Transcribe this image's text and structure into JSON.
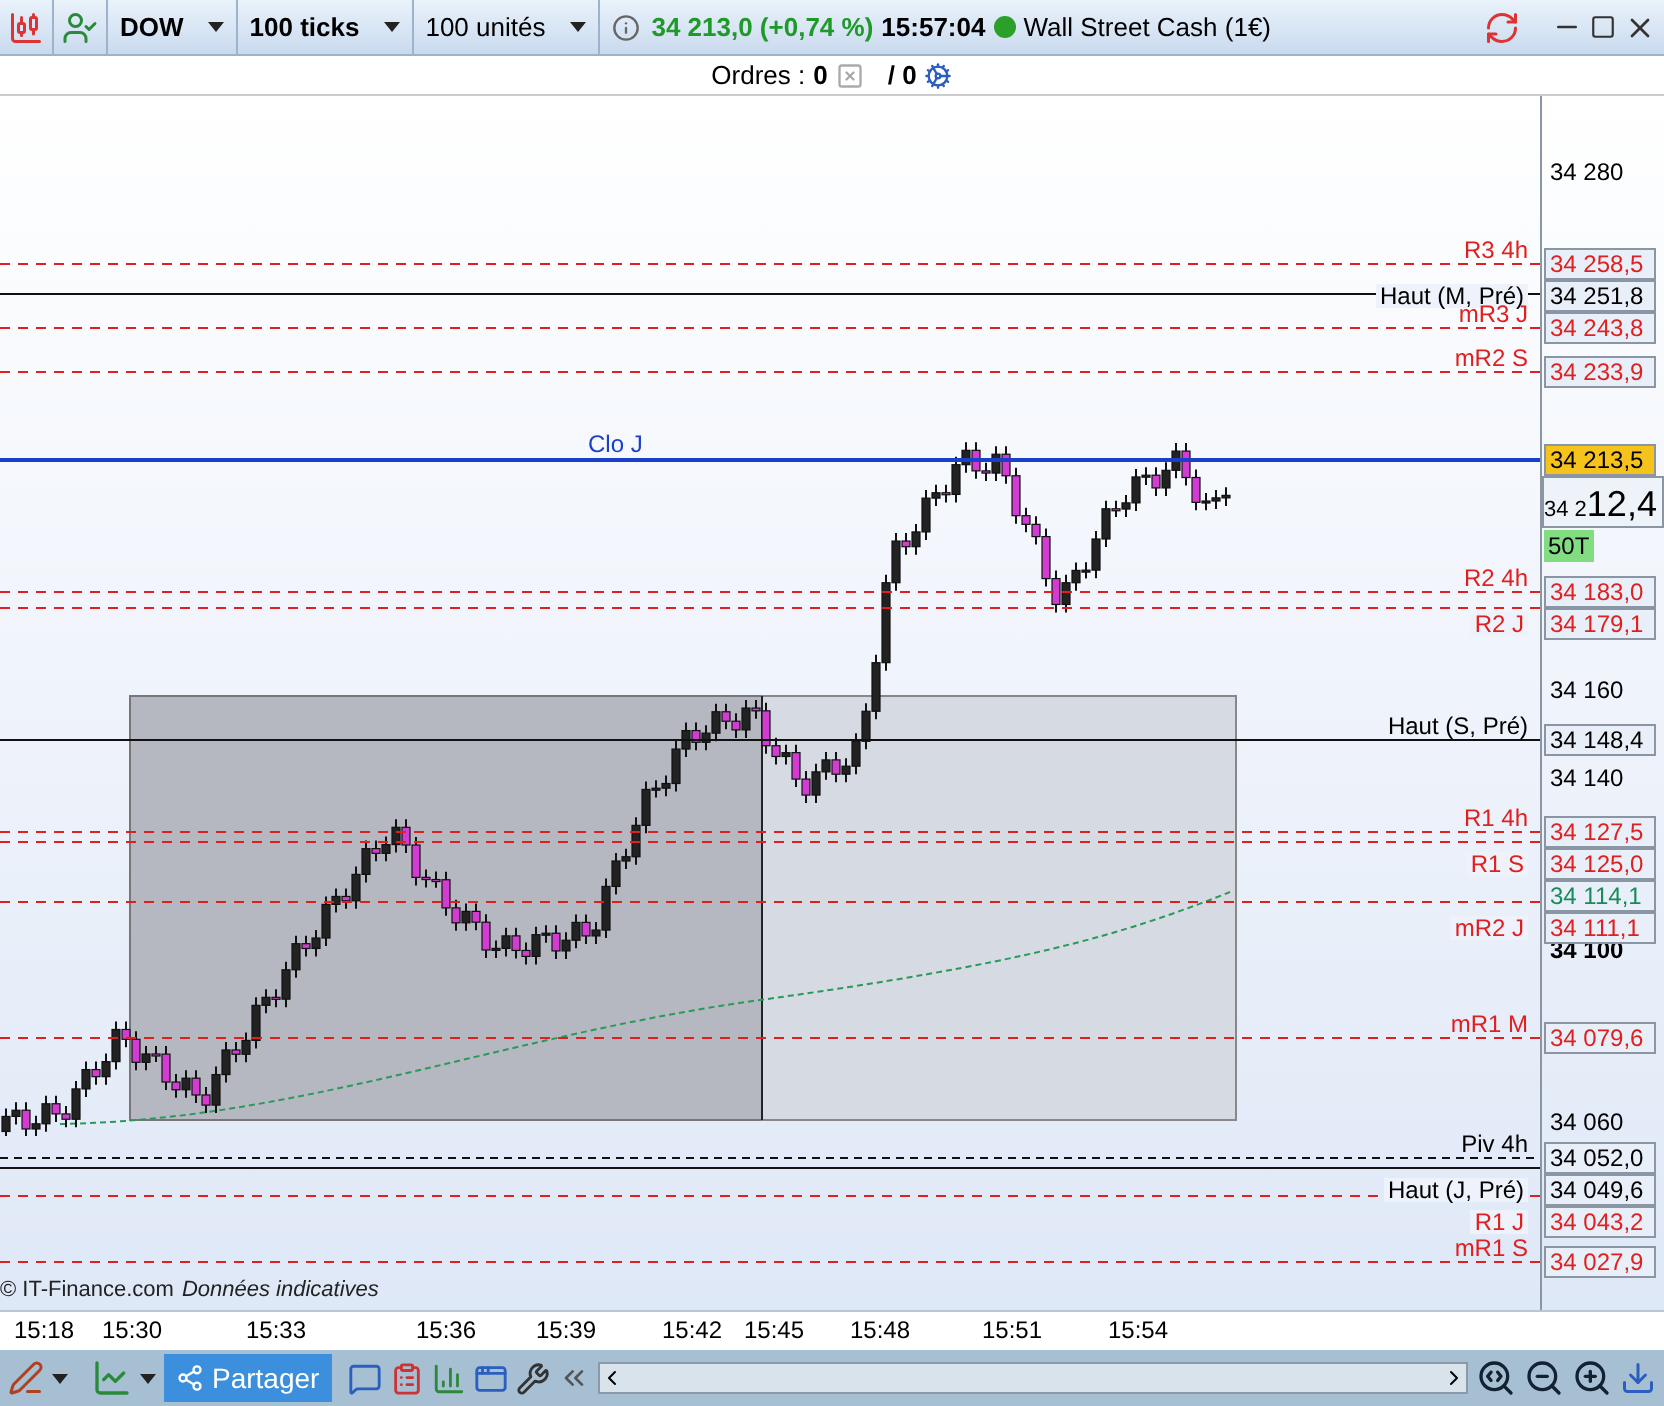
{
  "toolbar": {
    "instrument": "DOW",
    "interval": "100 ticks",
    "quantity": "100 unités",
    "price": "34 213,0 (+0,74 %)",
    "time": "15:57:04",
    "market": "Wall Street Cash (1€)",
    "market_open": true
  },
  "orders": {
    "label": "Ordres :",
    "count": "0",
    "separator": "/ 0"
  },
  "chart": {
    "levels": [
      {
        "label": "R3 4h",
        "value": "34 258,5",
        "kind": "resistance"
      },
      {
        "label": "Haut (M, Pré)",
        "value": "34 251,8",
        "kind": "high"
      },
      {
        "label": "mR3 J",
        "value": "34 243,8",
        "kind": "resistance"
      },
      {
        "label": "mR2 S",
        "value": "34 233,9",
        "kind": "resistance"
      },
      {
        "label": "Clo J",
        "value": "34 213,5",
        "kind": "close"
      },
      {
        "label": "R2 4h",
        "value": "34 183,0",
        "kind": "resistance"
      },
      {
        "label": "R2 J",
        "value": "34 179,1",
        "kind": "resistance"
      },
      {
        "label": "Haut (S, Pré)",
        "value": "34 148,4",
        "kind": "high"
      },
      {
        "label": "R1 4h",
        "value": "34 127,5",
        "kind": "resistance"
      },
      {
        "label": "R1 S",
        "value": "34 125,0",
        "kind": "resistance"
      },
      {
        "label": "mR2 J",
        "value": "34 111,1",
        "kind": "resistance"
      },
      {
        "label": "mR1 M",
        "value": "34 079,6",
        "kind": "resistance"
      },
      {
        "label": "Piv 4h",
        "value": "34 052,0",
        "kind": "pivot"
      },
      {
        "label": "Haut (J, Pré)",
        "value": "34 049,6",
        "kind": "high"
      },
      {
        "label": "R1 J",
        "value": "34 043,2",
        "kind": "resistance"
      },
      {
        "label": "mR1 S",
        "value": "34 027,9",
        "kind": "resistance"
      }
    ],
    "price_ticks": [
      {
        "label": "34 280",
        "emphasized": false
      },
      {
        "label": "34 160",
        "emphasized": false
      },
      {
        "label": "34 140",
        "emphasized": false
      },
      {
        "label": "34 100",
        "emphasized": true
      },
      {
        "label": "34 060",
        "emphasized": false
      }
    ],
    "current_price": {
      "prefix": "34 2",
      "suffix": "12,4"
    },
    "tick_count": "50T",
    "average_value": "34 114,1",
    "copyright": "© IT-Finance.com",
    "note": "Données indicatives",
    "time_labels": [
      "15:18",
      "15:30",
      "15:33",
      "15:36",
      "15:39",
      "15:42",
      "15:45",
      "15:48",
      "15:51",
      "15:54"
    ]
  },
  "bottom_toolbar": {
    "share": "Partager"
  }
}
